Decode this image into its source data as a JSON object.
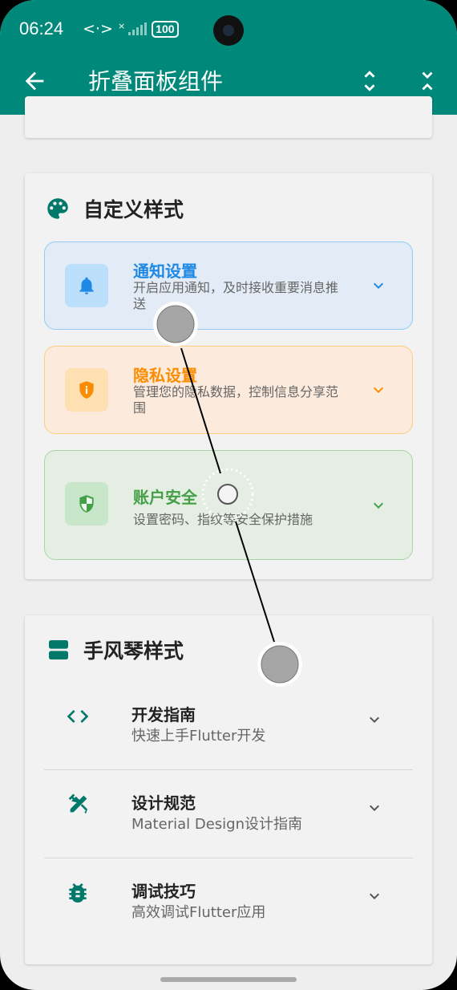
{
  "status_bar": {
    "time": "06:24",
    "network": "<·>",
    "signal_label": "×",
    "battery": "100"
  },
  "app_bar": {
    "title": "折叠面板组件",
    "colors": {
      "primary": "#00897b"
    }
  },
  "custom_section": {
    "title": "自定义样式",
    "panels": [
      {
        "title": "通知设置",
        "subtitle": "开启应用通知，及时接收重要消息推送",
        "color": "#1e88e5",
        "bg": "#e3ecf6",
        "border": "#90caf9",
        "icon": "bell-icon"
      },
      {
        "title": "隐私设置",
        "subtitle": "管理您的隐私数据，控制信息分享范围",
        "color": "#fb8c00",
        "bg": "#fcebdc",
        "border": "#ffcc80",
        "icon": "privacy-shield-icon"
      },
      {
        "title": "账户安全",
        "subtitle": "设置密码、指纹等安全保护措施",
        "color": "#43a047",
        "bg": "#e5eee3",
        "border": "#a5d6a7",
        "icon": "security-shield-icon"
      }
    ]
  },
  "accordion_section": {
    "title": "手风琴样式",
    "items": [
      {
        "title": "开发指南",
        "subtitle": "快速上手Flutter开发",
        "icon": "code-icon"
      },
      {
        "title": "设计规范",
        "subtitle": "Material Design设计指南",
        "icon": "design-tools-icon"
      },
      {
        "title": "调试技巧",
        "subtitle": "高效调试Flutter应用",
        "icon": "bug-icon"
      }
    ]
  }
}
